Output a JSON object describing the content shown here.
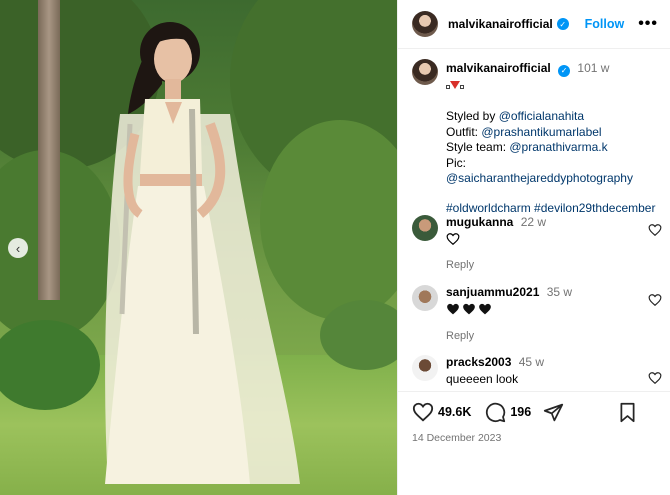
{
  "post": {
    "username": "malvikanairofficial",
    "follow_label": "Follow",
    "more_label": "•••",
    "caption": {
      "username": "malvikanairofficial",
      "time": "101 w",
      "styled_by_label": "Styled by ",
      "styled_by": "@officialanahita",
      "outfit_label": "Outfit: ",
      "outfit": "@prashantikumarlabel",
      "style_team_label": "Style team: ",
      "style_team": "@pranathivarma.k",
      "pic_label": "Pic: ",
      "pic": "@saicharanthejareddyphotography",
      "hashtag1": "#oldworldcharm",
      "hashtag2": "#devilon29thdecember"
    },
    "comments": [
      {
        "username": "mugukanna",
        "time": "22 w",
        "text": "",
        "reply": "Reply"
      },
      {
        "username": "sanjuammu2021",
        "time": "35 w",
        "text": "",
        "reply": "Reply"
      },
      {
        "username": "pracks2003",
        "time": "45 w",
        "text": "queeeen look",
        "reply": ""
      }
    ],
    "likes": "49.6K",
    "comments_count": "196",
    "date": "14 December 2023"
  },
  "colors": {
    "accent": "#0095f6",
    "link": "#00376b",
    "muted": "#737373"
  },
  "icons": [
    "chevron-left-icon",
    "verified-icon",
    "heart-icon",
    "comment-icon",
    "share-icon",
    "bookmark-icon"
  ]
}
